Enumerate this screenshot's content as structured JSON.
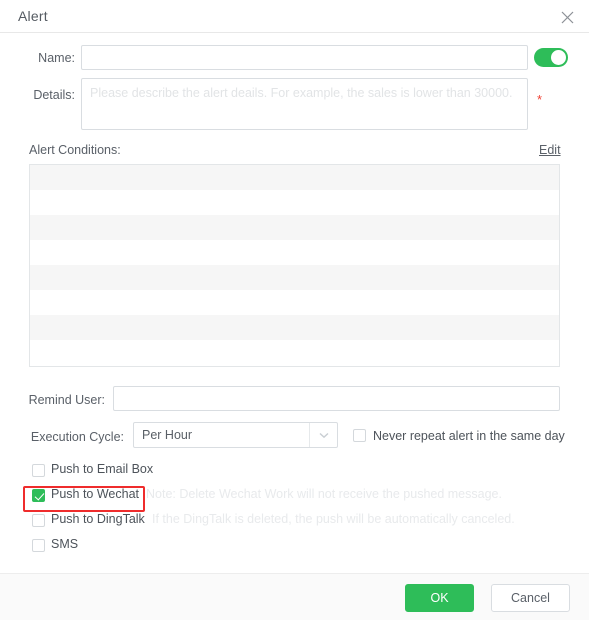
{
  "window": {
    "title": "Alert",
    "close_icon": "close-icon"
  },
  "form": {
    "name": {
      "label": "Name:",
      "value": "",
      "placeholder": ""
    },
    "enabled_toggle": {
      "state": "on",
      "color": "#2ebd59"
    },
    "details": {
      "label": "Details:",
      "value": "",
      "placeholder": "Please describe the alert deails. For example, the sales is lower than 30000.",
      "required_marker": "*",
      "required_color": "#f04134"
    },
    "alert_conditions": {
      "label": "Alert Conditions:",
      "edit_link": "Edit",
      "rows": [],
      "empty_row_count": 8
    },
    "remind_user": {
      "label": "Remind User:",
      "value": "",
      "placeholder": ""
    },
    "execution_cycle": {
      "label": "Execution Cycle:",
      "selected": "Per Hour",
      "options": [
        "Per Hour"
      ],
      "arrow_icon": "chevron-down-icon"
    },
    "never_repeat": {
      "label": "Never repeat alert in the same day",
      "checked": false
    }
  },
  "push_options": [
    {
      "label": "Push to Email Box",
      "note": "",
      "checked": false
    },
    {
      "label": "Push to Wechat",
      "note": "Note: Delete Wechat Work will not receive the pushed message.",
      "checked": true
    },
    {
      "label": "Push to DingTalk",
      "note": "If the DingTalk is deleted, the push will be automatically canceled.",
      "checked": false
    },
    {
      "label": "SMS",
      "note": "",
      "checked": false
    }
  ],
  "highlight": {
    "color": "#ef2c2c",
    "target": "Push to Wechat"
  },
  "footer": {
    "ok_label": "OK",
    "cancel_label": "Cancel",
    "ok_color": "#2ebd59"
  }
}
